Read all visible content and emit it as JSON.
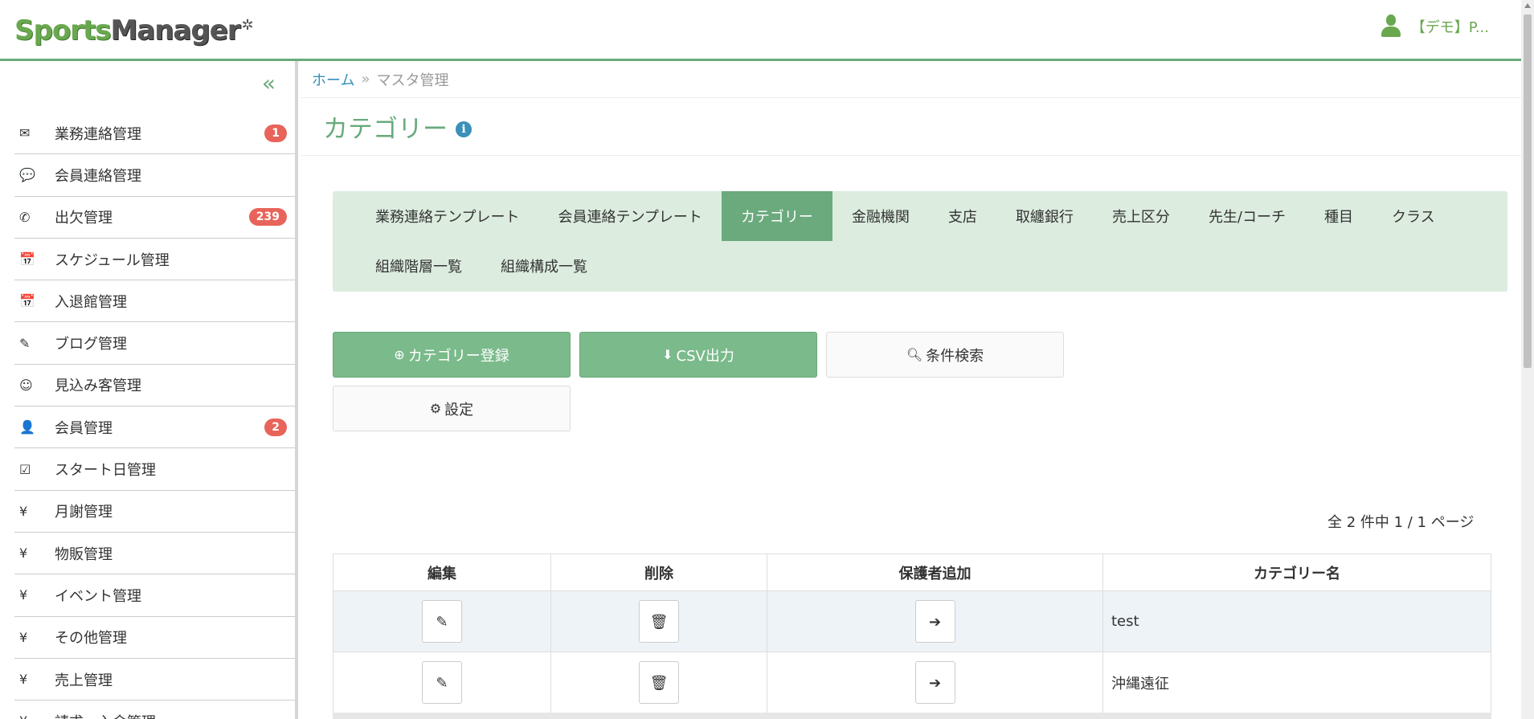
{
  "header": {
    "logo_sports": "Sports",
    "logo_manager": "Manager",
    "user_name": "【デモ】P..."
  },
  "sidebar": {
    "collapse_label": "«",
    "items": [
      {
        "icon": "envelope-icon",
        "glyph": "✉",
        "label": "業務連絡管理",
        "badge": "1"
      },
      {
        "icon": "comment-icon",
        "glyph": "💬",
        "label": "会員連絡管理",
        "badge": ""
      },
      {
        "icon": "phone-icon",
        "glyph": "✆",
        "label": "出欠管理",
        "badge": "239"
      },
      {
        "icon": "calendar-icon",
        "glyph": "📅",
        "label": "スケジュール管理",
        "badge": ""
      },
      {
        "icon": "calendar-icon",
        "glyph": "📅",
        "label": "入退館管理",
        "badge": ""
      },
      {
        "icon": "pencil-icon",
        "glyph": "✎",
        "label": "ブログ管理",
        "badge": ""
      },
      {
        "icon": "smile-icon",
        "glyph": "☺",
        "label": "見込み客管理",
        "badge": ""
      },
      {
        "icon": "user-icon",
        "glyph": "👤",
        "label": "会員管理",
        "badge": "2"
      },
      {
        "icon": "check-square-icon",
        "glyph": "☑",
        "label": "スタート日管理",
        "badge": ""
      },
      {
        "icon": "yen-icon",
        "glyph": "¥",
        "label": "月謝管理",
        "badge": ""
      },
      {
        "icon": "yen-icon",
        "glyph": "¥",
        "label": "物販管理",
        "badge": ""
      },
      {
        "icon": "yen-icon",
        "glyph": "¥",
        "label": "イベント管理",
        "badge": ""
      },
      {
        "icon": "yen-icon",
        "glyph": "¥",
        "label": "その他管理",
        "badge": ""
      },
      {
        "icon": "yen-icon",
        "glyph": "¥",
        "label": "売上管理",
        "badge": ""
      },
      {
        "icon": "yen-icon",
        "glyph": "¥",
        "label": "請求・入金管理",
        "badge": ""
      }
    ]
  },
  "breadcrumb": {
    "home": "ホーム",
    "sep": "»",
    "current": "マスタ管理"
  },
  "page": {
    "title": "カテゴリー",
    "info": "i"
  },
  "tabs": {
    "row1": [
      "業務連絡テンプレート",
      "会員連絡テンプレート",
      "カテゴリー",
      "金融機関",
      "支店",
      "取纏銀行",
      "売上区分",
      "先生/コーチ",
      "種目",
      "クラス"
    ],
    "row2": [
      "組織階層一覧",
      "組織構成一覧"
    ],
    "active": "カテゴリー"
  },
  "buttons": {
    "register": "カテゴリー登録",
    "csv": "CSV出力",
    "search": "条件検索",
    "settings": "設定"
  },
  "pagination": {
    "info": "全 2 件中 1 / 1 ページ"
  },
  "table": {
    "headers": [
      "編集",
      "削除",
      "保護者追加",
      "カテゴリー名"
    ],
    "rows": [
      {
        "name": "test"
      },
      {
        "name": "沖縄遠征"
      }
    ]
  },
  "colors": {
    "accent": "#6aaa7d",
    "badge": "#e8645a",
    "link": "#3a90b8"
  }
}
